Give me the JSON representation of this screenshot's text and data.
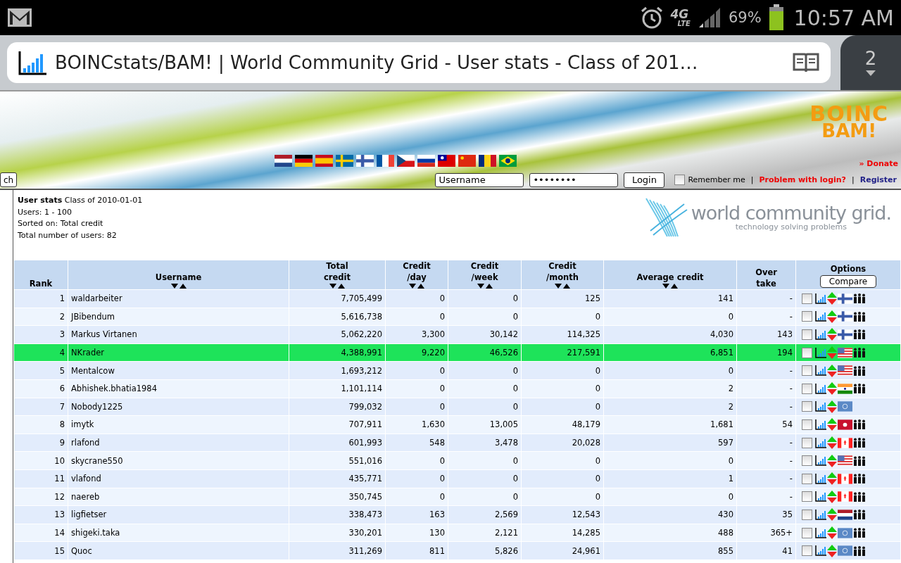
{
  "status_bar": {
    "network": "4G",
    "network_sub": "LTE",
    "battery": "69%",
    "time": "10:57 AM"
  },
  "browser": {
    "title": "BOINCstats/BAM! | World Community Grid - User stats - Class of 201…",
    "tab_count": "2"
  },
  "banner": {
    "logo_top": "BOINC",
    "logo_bottom": "BAM!",
    "donate": "» Donate",
    "language_flags": [
      {
        "kind": "nl"
      },
      {
        "kind": "de"
      },
      {
        "kind": "es"
      },
      {
        "kind": "se"
      },
      {
        "kind": "fi"
      },
      {
        "kind": "fr"
      },
      {
        "kind": "cz"
      },
      {
        "kind": "ru"
      },
      {
        "kind": "tw"
      },
      {
        "kind": "cn"
      },
      {
        "kind": "ro"
      },
      {
        "kind": "br"
      }
    ]
  },
  "login": {
    "search_button": "ch",
    "username": "Username",
    "password": "••••••••",
    "login_button": "Login",
    "remember": {
      "label": "Remember me",
      "checked": false
    },
    "problem_link": "Problem with login?",
    "separator_1": "|",
    "separator_2": "|",
    "register_link": "Register"
  },
  "info": {
    "heading": "**User stats**  Class of 2010-01-01",
    "lines": [
      "Users: 1 - 100",
      "Sorted on: Total credit",
      "Total number of users: 82"
    ]
  },
  "wcg_logo": {
    "name": "world community grid.",
    "tagline": "technology solving problems"
  },
  "table": {
    "columns": [
      {
        "label": "Rank",
        "sortable": false
      },
      {
        "label": "Username",
        "sortable": true
      },
      {
        "label": "Total\ncredit",
        "sortable": true
      },
      {
        "label": "Credit\n/day",
        "sortable": true
      },
      {
        "label": "Credit\n/week",
        "sortable": true
      },
      {
        "label": "Credit\n/month",
        "sortable": true
      },
      {
        "label": "Average credit",
        "sortable": true
      },
      {
        "label": "Over\ntake",
        "sortable": false
      },
      {
        "label": "Options",
        "sortable": false,
        "button": "Compare"
      }
    ],
    "rows": [
      {
        "cells": [
          "1",
          "waldarbeiter",
          "7,705,499",
          "0",
          "0",
          "125",
          "141",
          "-"
        ],
        "highlighted": false,
        "checked": false,
        "flag": {
          "kind": "fi"
        },
        "team": true
      },
      {
        "cells": [
          "2",
          "JBibendum",
          "5,616,738",
          "0",
          "0",
          "0",
          "0",
          "-"
        ],
        "highlighted": false,
        "checked": false,
        "flag": {
          "kind": "fi"
        },
        "team": true
      },
      {
        "cells": [
          "3",
          "Markus Virtanen",
          "5,062,220",
          "3,300",
          "30,142",
          "114,325",
          "4,030",
          "143"
        ],
        "highlighted": false,
        "checked": false,
        "flag": {
          "kind": "fi"
        },
        "team": true
      },
      {
        "cells": [
          "4",
          "NKrader",
          "4,388,991",
          "9,220",
          "46,526",
          "217,591",
          "6,851",
          "194"
        ],
        "highlighted": true,
        "checked": false,
        "flag": {
          "kind": "us"
        },
        "team": true
      },
      {
        "cells": [
          "5",
          "Mentalcow",
          "1,693,212",
          "0",
          "0",
          "0",
          "0",
          "-"
        ],
        "highlighted": false,
        "checked": false,
        "flag": {
          "kind": "us"
        },
        "team": true
      },
      {
        "cells": [
          "6",
          "Abhishek.bhatia1984",
          "1,101,114",
          "0",
          "0",
          "0",
          "2",
          "-"
        ],
        "highlighted": false,
        "checked": false,
        "flag": {
          "kind": "in"
        },
        "team": true
      },
      {
        "cells": [
          "7",
          "Nobody1225",
          "799,032",
          "0",
          "0",
          "0",
          "2",
          "-"
        ],
        "highlighted": false,
        "checked": false,
        "flag": {
          "kind": "un"
        },
        "team": false
      },
      {
        "cells": [
          "8",
          "imytk",
          "707,911",
          "1,630",
          "13,005",
          "48,179",
          "1,681",
          "54"
        ],
        "highlighted": false,
        "checked": false,
        "flag": {
          "kind": "hk"
        },
        "team": true
      },
      {
        "cells": [
          "9",
          "rlafond",
          "601,993",
          "548",
          "3,478",
          "20,028",
          "597",
          "-"
        ],
        "highlighted": false,
        "checked": false,
        "flag": {
          "kind": "ca"
        },
        "team": true
      },
      {
        "cells": [
          "10",
          "skycrane550",
          "551,016",
          "0",
          "0",
          "0",
          "0",
          "-"
        ],
        "highlighted": false,
        "checked": false,
        "flag": {
          "kind": "us"
        },
        "team": true
      },
      {
        "cells": [
          "11",
          "vlafond",
          "435,771",
          "0",
          "0",
          "0",
          "1",
          "-"
        ],
        "highlighted": false,
        "checked": false,
        "flag": {
          "kind": "ca"
        },
        "team": true
      },
      {
        "cells": [
          "12",
          "naereb",
          "350,745",
          "0",
          "0",
          "0",
          "0",
          "-"
        ],
        "highlighted": false,
        "checked": false,
        "flag": {
          "kind": "ca"
        },
        "team": true
      },
      {
        "cells": [
          "13",
          "ligfietser",
          "338,473",
          "163",
          "2,569",
          "12,543",
          "430",
          "35"
        ],
        "highlighted": false,
        "checked": false,
        "flag": {
          "kind": "nl"
        },
        "team": true
      },
      {
        "cells": [
          "14",
          "shigeki.taka",
          "330,201",
          "130",
          "2,121",
          "14,285",
          "488",
          "365+"
        ],
        "highlighted": false,
        "checked": false,
        "flag": {
          "kind": "un"
        },
        "team": true
      },
      {
        "cells": [
          "15",
          "Quoc",
          "311,269",
          "811",
          "5,826",
          "24,961",
          "855",
          "41"
        ],
        "highlighted": false,
        "checked": false,
        "flag": {
          "kind": "un"
        },
        "team": true
      }
    ]
  }
}
